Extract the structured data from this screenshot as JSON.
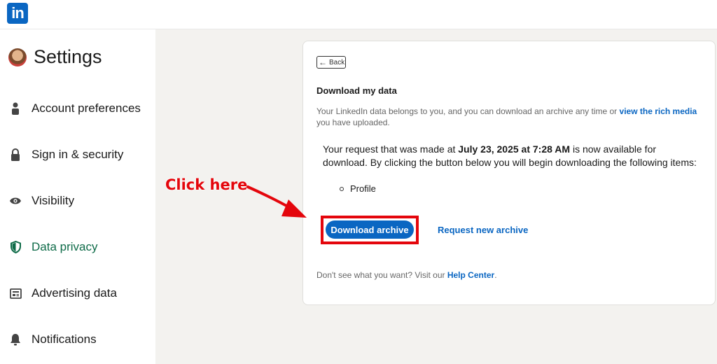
{
  "topbar": {
    "logo_text": "in"
  },
  "sidebar": {
    "title": "Settings",
    "items": [
      {
        "label": "Account preferences",
        "icon": "person-icon"
      },
      {
        "label": "Sign in & security",
        "icon": "lock-icon"
      },
      {
        "label": "Visibility",
        "icon": "eye-icon"
      },
      {
        "label": "Data privacy",
        "icon": "shield-icon",
        "active": true
      },
      {
        "label": "Advertising data",
        "icon": "newspaper-icon"
      },
      {
        "label": "Notifications",
        "icon": "bell-icon"
      }
    ]
  },
  "card": {
    "back_label": "Back",
    "title": "Download my data",
    "desc_pre": "Your LinkedIn data belongs to you, and you can download an archive any time or ",
    "desc_link": "view the rich media",
    "desc_post": " you have uploaded.",
    "request_pre": "Your request that was made at ",
    "request_date": "July 23, 2025 at 7:28 AM",
    "request_post": " is now available for download. By clicking the button below you will begin downloading the following items:",
    "items": [
      "Profile"
    ],
    "download_label": "Download archive",
    "request_new_label": "Request new archive",
    "help_pre": "Don't see what you want? Visit our ",
    "help_link": "Help Center",
    "help_post": "."
  },
  "annotation": {
    "text": "Click here",
    "color": "#e4060c"
  },
  "colors": {
    "brand": "#0a66c2",
    "active_nav": "#0e6b48",
    "background": "#f3f2ef"
  }
}
